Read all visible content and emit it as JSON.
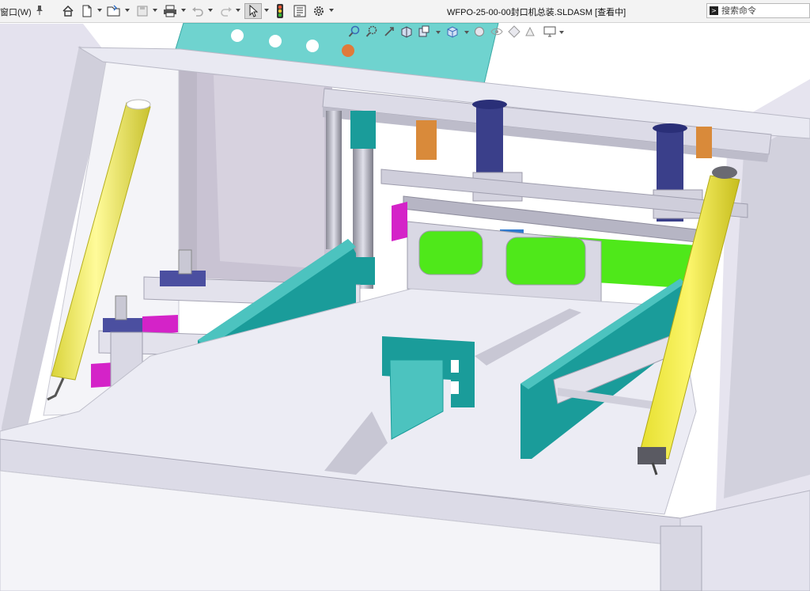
{
  "menu": {
    "window_label": "窗口(W)"
  },
  "document": {
    "title": "WFPO-25-00-00封口机总装.SLDASM [查看中]"
  },
  "toolbar": {
    "buttons": [
      {
        "name": "home-icon"
      },
      {
        "name": "new-document-icon"
      },
      {
        "name": "open-folder-icon"
      },
      {
        "name": "save-icon"
      },
      {
        "name": "print-icon"
      },
      {
        "name": "undo-icon"
      },
      {
        "name": "redo-icon"
      },
      {
        "name": "select-pointer-icon"
      },
      {
        "name": "traffic-light-icon"
      },
      {
        "name": "file-properties-icon"
      },
      {
        "name": "options-gear-icon"
      }
    ]
  },
  "search": {
    "placeholder": "搜索命令"
  },
  "heads_up_toolbar": {
    "tools": [
      "zoom-to-fit-icon",
      "zoom-to-area-icon",
      "previous-view-icon",
      "section-view-icon",
      "dynamic-annotation-icon",
      "view-orientation-icon",
      "display-style-icon",
      "hide-show-items-icon",
      "edit-appearance-icon",
      "apply-scene-icon",
      "view-settings-icon"
    ]
  },
  "colors": {
    "frame": "#cfcfdc",
    "frame_light": "#e9e9f0",
    "teal": "#1a9c9a",
    "teal_light": "#6fd3cf",
    "yellow": "#f4f05a",
    "green": "#4fe81a",
    "magenta": "#d423c8",
    "navy": "#2a2f78",
    "orange": "#d98a3a",
    "background": "#ffffff"
  }
}
